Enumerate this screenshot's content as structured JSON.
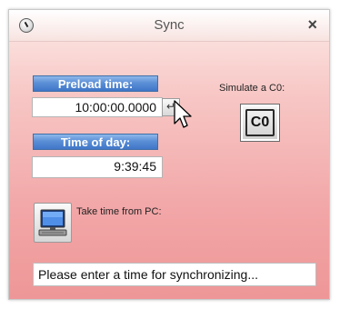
{
  "window": {
    "title": "Sync",
    "close_label": "×"
  },
  "preload": {
    "label": "Preload time:",
    "value": "10:00:00.0000",
    "enter_label": "↵"
  },
  "simulate": {
    "label": "Simulate a C0:",
    "button_label": "C0"
  },
  "time_of_day": {
    "label": "Time of day:",
    "value": "9:39:45"
  },
  "pc": {
    "label": "Take time from PC:"
  },
  "status": {
    "text": "Please enter a time for synchronizing..."
  }
}
